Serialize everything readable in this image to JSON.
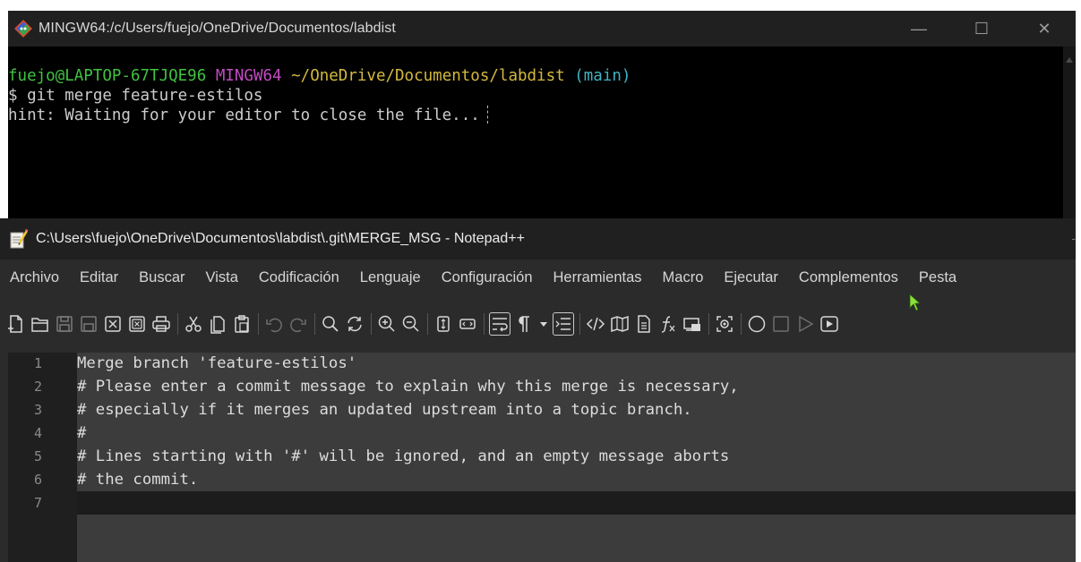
{
  "terminal": {
    "title": "MINGW64:/c/Users/fuejo/OneDrive/Documentos/labdist",
    "controls": {
      "minimize": "—",
      "maximize": "☐",
      "close": "✕"
    },
    "prompt": {
      "user_host": "fuejo@LAPTOP-67TJQE96",
      "system": "MINGW64",
      "path": "~/OneDrive/Documentos/labdist",
      "branch": "(main)"
    },
    "command_line": "$ git merge feature-estilos",
    "hint_line": "hint: Waiting for your editor to close the file..."
  },
  "notepad": {
    "title": "C:\\Users\\fuejo\\OneDrive\\Documentos\\labdist\\.git\\MERGE_MSG - Notepad++",
    "title_dash": "-",
    "menu": [
      "Archivo",
      "Editar",
      "Buscar",
      "Vista",
      "Codificación",
      "Lenguaje",
      "Configuración",
      "Herramientas",
      "Macro",
      "Ejecutar",
      "Complementos",
      "Pesta"
    ],
    "lines": [
      {
        "num": "1",
        "text": "Merge branch 'feature-estilos'"
      },
      {
        "num": "2",
        "text": "# Please enter a commit message to explain why this merge is necessary,"
      },
      {
        "num": "3",
        "text": "# especially if it merges an updated upstream into a topic branch."
      },
      {
        "num": "4",
        "text": "#"
      },
      {
        "num": "5",
        "text": "# Lines starting with '#' will be ignored, and an empty message aborts"
      },
      {
        "num": "6",
        "text": "# the commit."
      },
      {
        "num": "7",
        "text": ""
      }
    ],
    "toolbar_icons": [
      "new-file-icon",
      "open-folder-icon",
      "save-icon",
      "save-all-icon",
      "close-icon",
      "close-all-icon",
      "print-icon",
      "cut-icon",
      "copy-icon",
      "paste-icon",
      "undo-icon",
      "redo-icon",
      "find-icon",
      "replace-icon",
      "zoom-in-icon",
      "zoom-out-icon",
      "sync-vertical-icon",
      "sync-horizontal-icon",
      "word-wrap-icon",
      "show-all-chars-icon",
      "dropdown-arrow-icon",
      "indent-guide-icon",
      "xml-tag-icon",
      "document-map-icon",
      "document-list-icon",
      "function-list-icon",
      "folder-workspace-icon",
      "monitoring-icon",
      "record-macro-icon",
      "stop-macro-icon",
      "play-macro-icon",
      "run-macro-multiple-icon"
    ]
  },
  "colors": {
    "terminal_bg": "#000000",
    "prompt_user": "#3fc33f",
    "prompt_system": "#c34ac3",
    "prompt_path": "#d4b93f",
    "prompt_branch": "#3fb5c3",
    "editor_bg": "#3c3c3c",
    "current_line_bg": "#1c1c1c"
  }
}
